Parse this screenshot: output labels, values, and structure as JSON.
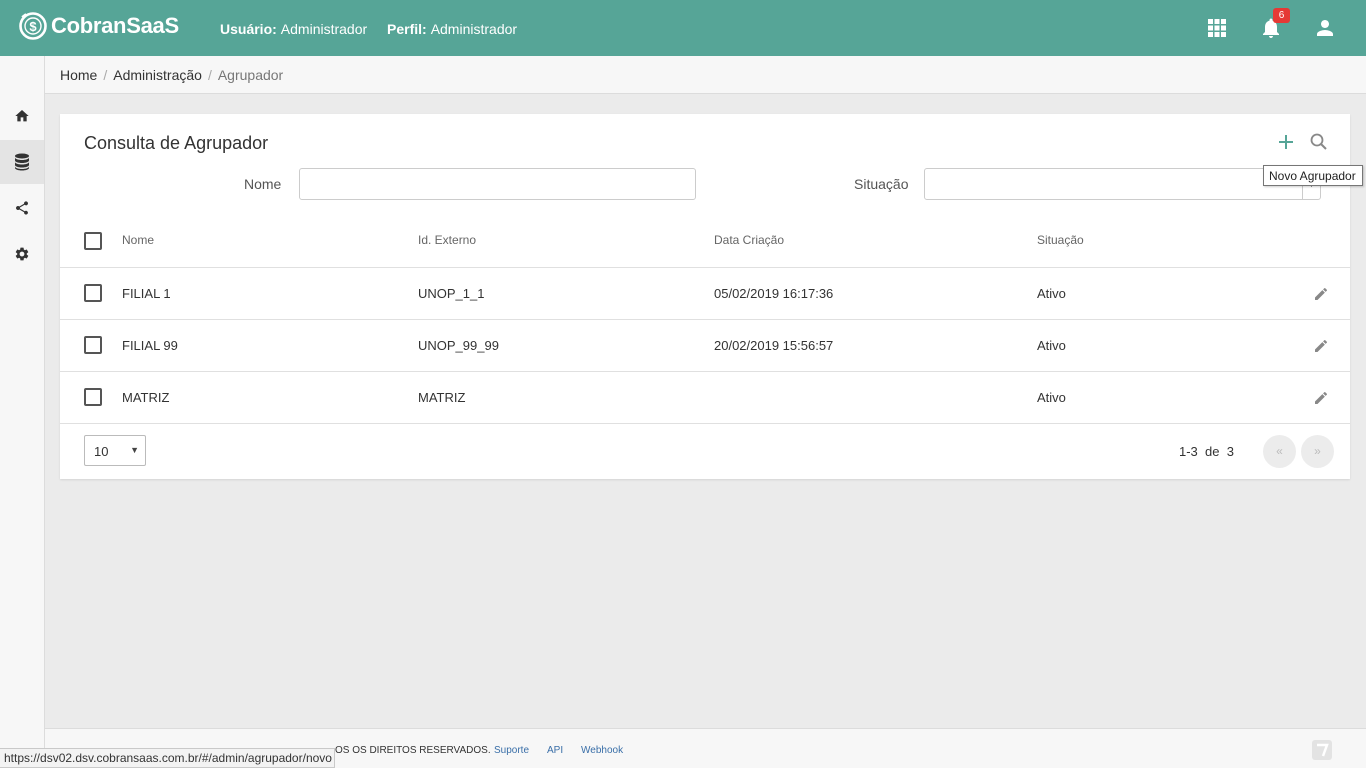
{
  "header": {
    "brand": "CobranSaaS",
    "user_label": "Usuário:",
    "user_value": "Administrador",
    "profile_label": "Perfil:",
    "profile_value": "Administrador",
    "notification_count": "6",
    "icons": [
      "apps-grid-icon",
      "bell-icon",
      "user-icon"
    ],
    "color": "#56a597"
  },
  "sidebar": {
    "items": [
      {
        "icon": "home-icon"
      },
      {
        "icon": "database-icon",
        "active": true
      },
      {
        "icon": "share-icon"
      },
      {
        "icon": "gear-icon"
      }
    ]
  },
  "breadcrumb": {
    "items": [
      "Home",
      "Administração",
      "Agrupador"
    ]
  },
  "card": {
    "title": "Consulta de Agrupador",
    "tooltip": "Novo Agrupador",
    "filters": {
      "nome_label": "Nome",
      "nome_value": "",
      "situacao_label": "Situação",
      "situacao_value": ""
    }
  },
  "table": {
    "columns": [
      "Nome",
      "Id. Externo",
      "Data Criação",
      "Situação"
    ],
    "rows": [
      {
        "nome": "FILIAL 1",
        "id_externo": "UNOP_1_1",
        "data_criacao": "05/02/2019 16:17:36",
        "situacao": "Ativo"
      },
      {
        "nome": "FILIAL 99",
        "id_externo": "UNOP_99_99",
        "data_criacao": "20/02/2019 15:56:57",
        "situacao": "Ativo"
      },
      {
        "nome": "MATRIZ",
        "id_externo": "MATRIZ",
        "data_criacao": "",
        "situacao": "Ativo"
      }
    ]
  },
  "pagination": {
    "page_size": "10",
    "range": "1-3",
    "of_label": "de",
    "total": "3",
    "prev": "«",
    "next": "»"
  },
  "footer": {
    "copyright": "OS OS DIREITOS RESERVADOS.",
    "links": [
      "Suporte",
      "API",
      "Webhook"
    ]
  },
  "status_url": "https://dsv02.dsv.cobransaas.com.br/#/admin/agrupador/novo"
}
